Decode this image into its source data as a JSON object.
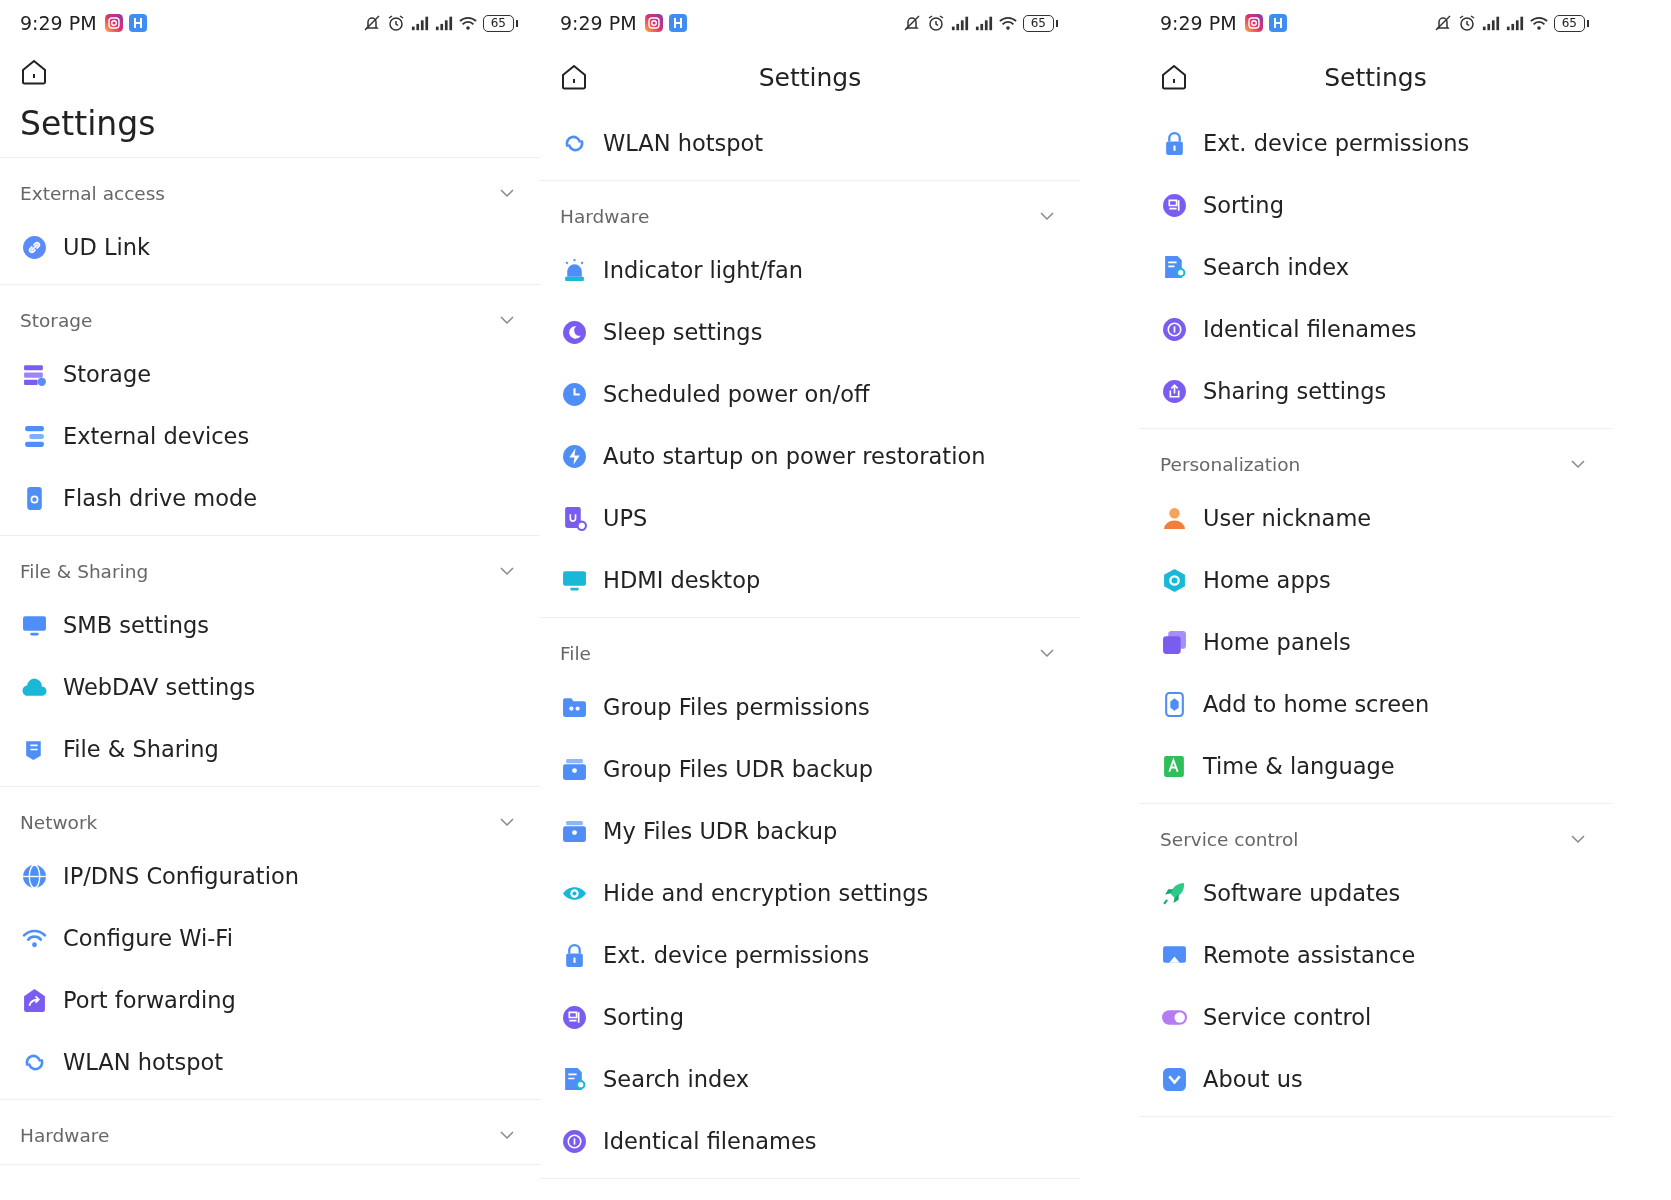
{
  "panels": [
    {
      "status_bar": {
        "time": "9:29 PM",
        "battery": "65"
      },
      "header": {
        "kind": "large",
        "title": "Settings"
      },
      "sections": [
        {
          "title": "External access",
          "items": [
            {
              "label": "UD Link"
            }
          ]
        },
        {
          "title": "Storage",
          "items": [
            {
              "label": "Storage"
            },
            {
              "label": "External devices"
            },
            {
              "label": "Flash drive mode"
            }
          ]
        },
        {
          "title": "File & Sharing",
          "items": [
            {
              "label": "SMB settings"
            },
            {
              "label": "WebDAV settings"
            },
            {
              "label": "File & Sharing"
            }
          ]
        },
        {
          "title": "Network",
          "items": [
            {
              "label": "IP/DNS Configuration"
            },
            {
              "label": "Configure Wi-Fi"
            },
            {
              "label": "Port forwarding"
            },
            {
              "label": "WLAN hotspot"
            }
          ]
        },
        {
          "title": "Hardware"
        }
      ]
    },
    {
      "status_bar": {
        "time": "9:29 PM",
        "battery": "65"
      },
      "header": {
        "kind": "bar",
        "title": "Settings"
      },
      "sections": [
        {
          "items": [
            {
              "label": "WLAN hotspot"
            }
          ]
        },
        {
          "title": "Hardware",
          "items": [
            {
              "label": "Indicator light/fan"
            },
            {
              "label": "Sleep settings"
            },
            {
              "label": "Scheduled power on/off"
            },
            {
              "label": "Auto startup on power restoration"
            },
            {
              "label": "UPS"
            },
            {
              "label": "HDMI desktop"
            }
          ]
        },
        {
          "title": "File",
          "items": [
            {
              "label": "Group Files permissions"
            },
            {
              "label": "Group Files UDR backup"
            },
            {
              "label": "My Files UDR backup"
            },
            {
              "label": "Hide and encryption settings"
            },
            {
              "label": "Ext. device permissions"
            },
            {
              "label": "Sorting"
            },
            {
              "label": "Search index"
            },
            {
              "label": "Identical filenames"
            }
          ]
        }
      ]
    },
    {
      "status_bar": {
        "time": "9:29 PM",
        "battery": "65"
      },
      "header": {
        "kind": "bar",
        "title": "Settings"
      },
      "sections": [
        {
          "items": [
            {
              "label": "Ext. device permissions"
            },
            {
              "label": "Sorting"
            },
            {
              "label": "Search index"
            },
            {
              "label": "Identical filenames"
            },
            {
              "label": "Sharing settings"
            }
          ]
        },
        {
          "title": "Personalization",
          "items": [
            {
              "label": "User nickname"
            },
            {
              "label": "Home apps"
            },
            {
              "label": "Home panels"
            },
            {
              "label": "Add to home screen"
            },
            {
              "label": "Time & language"
            }
          ]
        },
        {
          "title": "Service control",
          "items": [
            {
              "label": "Software updates"
            },
            {
              "label": "Remote assistance"
            },
            {
              "label": "Service control"
            },
            {
              "label": "About us"
            }
          ]
        }
      ]
    }
  ]
}
